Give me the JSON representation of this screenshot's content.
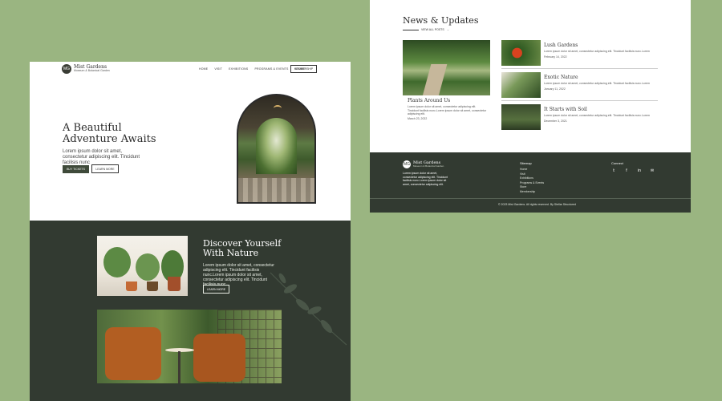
{
  "left_page": {
    "logo": {
      "mark": "MG",
      "name": "Mist Gardens",
      "sub": "Museum & Botanical Garden"
    },
    "nav": [
      "HOME",
      "VISIT",
      "EXHIBITIONS",
      "PROGRAMS & EVENTS",
      "STORE"
    ],
    "membership_btn": "MEMBERSHIP",
    "hero": {
      "title": "A Beautiful Adventure Awaits",
      "text": "Lorem ipsum dolor sit amet, consectetur adipiscing elit. Tincidunt facilisis nunc",
      "btn_primary": "BUY TICKETS",
      "btn_secondary": "LEARN MORE"
    },
    "discover": {
      "title": "Discover Yourself With Nature",
      "text": "Lorem ipsum dolor sit amet, consectetur adipiscing elit. Tincidunt facilisis nunc.Lorem ipsum dolor sit amet, consectetur adipiscing elit. Tincidunt facilisis nunc",
      "btn": "LEARN MORE"
    }
  },
  "right_page": {
    "news": {
      "title": "News & Updates",
      "view_all": "VIEW ALL POSTS",
      "featured": {
        "title": "Plants Around Us",
        "text": "Lorem ipsum dolor sit amet, consectetur adipiscing elit. Tincidunt facilisis nunc.Lorem ipsum dolor sit amet, consectetur adipiscing elit.",
        "date": "March 23, 2022"
      },
      "cards": [
        {
          "title": "Lush Gardens",
          "text": "Lorem ipsum dolor sit amet, consectetur adipiscing elit. Tincidunt facilisis nunc.Lorem",
          "date": "February 14, 2022"
        },
        {
          "title": "Exotic Nature",
          "text": "Lorem ipsum dolor sit amet, consectetur adipiscing elit. Tincidunt facilisis nunc.Lorem",
          "date": "January 11, 2022"
        },
        {
          "title": "It Starts with Soil",
          "text": "Lorem ipsum dolor sit amet, consectetur adipiscing elit. Tincidunt facilisis nunc.Lorem",
          "date": "December 3, 2021"
        }
      ]
    },
    "footer": {
      "logo": {
        "mark": "MG",
        "name": "Mist Gardens",
        "sub": "Museum & Botanical Garden"
      },
      "about": "Lorem ipsum dolor sit amet, consectetur adipiscing elit. Tincidunt facilisis nunc.Lorem ipsum dolor sit amet, consectetur adipiscing elit.",
      "sitemap_title": "Sitemap",
      "sitemap": [
        "Home",
        "Visit",
        "Exhibitions",
        "Programs & Events",
        "Store",
        "Membership"
      ],
      "connect_title": "Connect",
      "social_icons": [
        "twitter-icon",
        "facebook-icon",
        "linkedin-icon",
        "email-icon"
      ],
      "social_glyphs": [
        "𝕥",
        "f",
        "in",
        "✉"
      ],
      "copyright": "© 2023 Mist Gardens. All rights reserved. By Stellar Structured"
    }
  },
  "colors": {
    "background": "#9ab581",
    "dark_green": "#323a31",
    "accent_button": "#3f4a3a"
  }
}
